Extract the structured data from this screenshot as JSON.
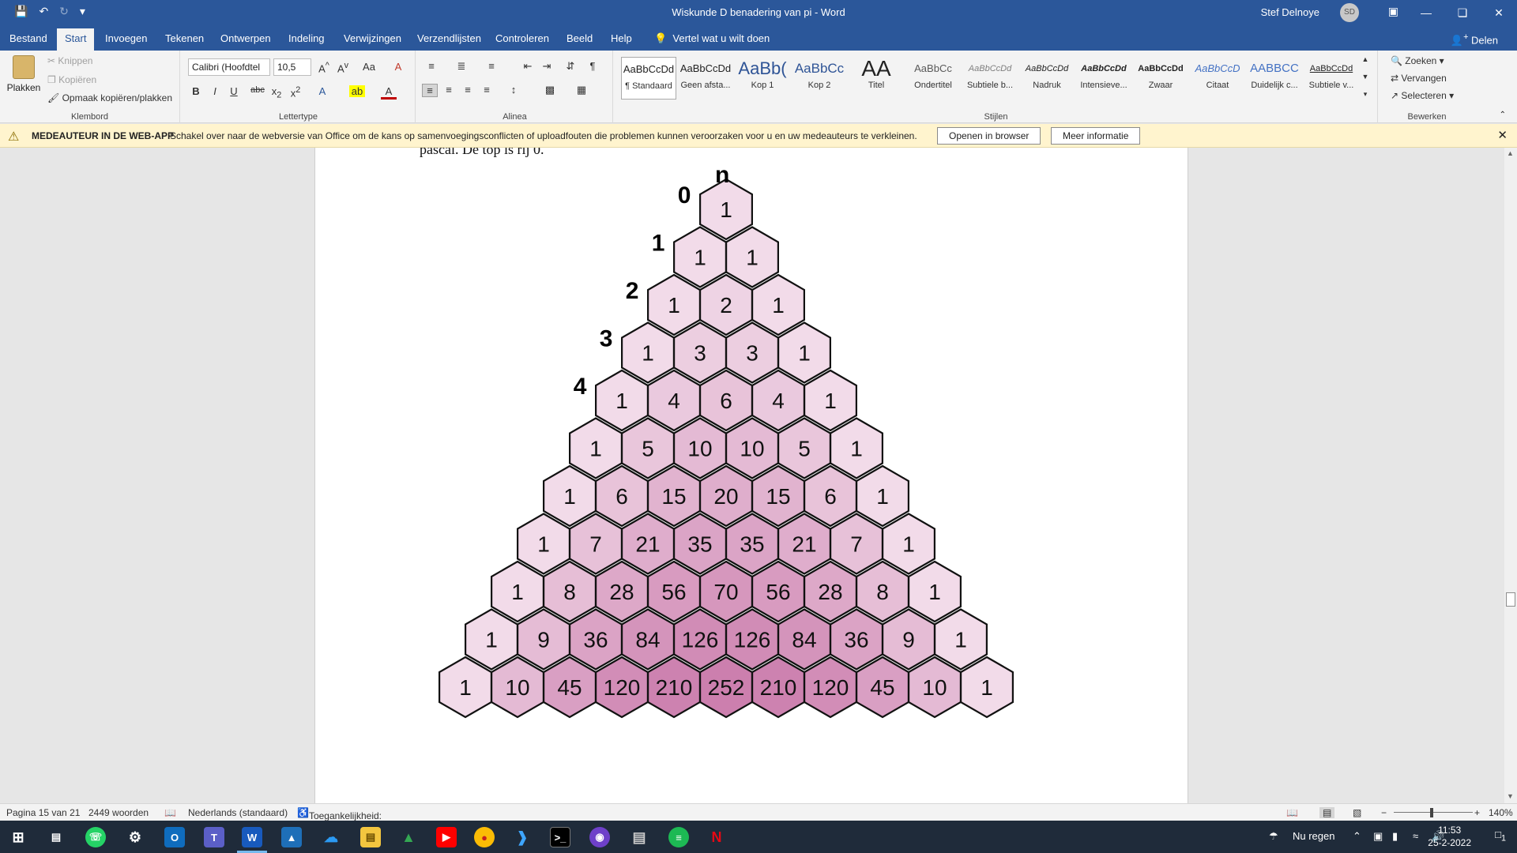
{
  "window": {
    "title": "Wiskunde D benadering van pi  -  Word",
    "user": "Stef Delnoye",
    "avatar_initials": "SD"
  },
  "tabs": [
    "Bestand",
    "Start",
    "Invoegen",
    "Tekenen",
    "Ontwerpen",
    "Indeling",
    "Verwijzingen",
    "Verzendlijsten",
    "Controleren",
    "Beeld",
    "Help"
  ],
  "tellme": "Vertel wat u wilt doen",
  "share": "Delen",
  "clipboard": {
    "paste": "Plakken",
    "cut": "Knippen",
    "copy": "Kopiëren",
    "format_painter": "Opmaak kopiëren/plakken",
    "label": "Klembord"
  },
  "font": {
    "name": "Calibri (Hoofdtel",
    "size": "10,5",
    "label": "Lettertype"
  },
  "paragraph_label": "Alinea",
  "styles": {
    "label": "Stijlen",
    "items": [
      {
        "sample": "AaBbCcDd",
        "name": "¶ Standaard"
      },
      {
        "sample": "AaBbCcDd",
        "name": "Geen afsta..."
      },
      {
        "sample": "AaBb(",
        "name": "Kop 1"
      },
      {
        "sample": "AaBbCc",
        "name": "Kop 2"
      },
      {
        "sample": "AA",
        "name": "Titel"
      },
      {
        "sample": "AaBbCc",
        "name": "Ondertitel"
      },
      {
        "sample": "AaBbCcDd",
        "name": "Subtiele b..."
      },
      {
        "sample": "AaBbCcDd",
        "name": "Nadruk"
      },
      {
        "sample": "AaBbCcDd",
        "name": "Intensieve..."
      },
      {
        "sample": "AaBbCcDd",
        "name": "Zwaar"
      },
      {
        "sample": "AaBbCcD",
        "name": "Citaat"
      },
      {
        "sample": "AABBCC",
        "name": "Duidelijk c..."
      },
      {
        "sample": "AaBbCcDd",
        "name": "Subtiele v..."
      }
    ]
  },
  "editing": {
    "find": "Zoeken",
    "replace": "Vervangen",
    "select": "Selecteren",
    "label": "Bewerken"
  },
  "message_bar": {
    "title": "MEDEAUTEUR IN DE WEB-APP",
    "text": "Schakel over naar de webversie van Office om de kans op samenvoegingsconflicten of uploadfouten die problemen kunnen veroorzaken voor u en uw medeauteurs te verkleinen.",
    "open_button": "Openen in browser",
    "info_button": "Meer informatie"
  },
  "document": {
    "partial_text": "pascal. De top is rij 0.",
    "n_label": "n",
    "row_labels": [
      "0",
      "1",
      "2",
      "3",
      "4"
    ]
  },
  "pascal_rows": [
    [
      1
    ],
    [
      1,
      1
    ],
    [
      1,
      2,
      1
    ],
    [
      1,
      3,
      3,
      1
    ],
    [
      1,
      4,
      6,
      4,
      1
    ],
    [
      1,
      5,
      10,
      10,
      5,
      1
    ],
    [
      1,
      6,
      15,
      20,
      15,
      6,
      1
    ],
    [
      1,
      7,
      21,
      35,
      35,
      21,
      7,
      1
    ],
    [
      1,
      8,
      28,
      56,
      70,
      56,
      28,
      8,
      1
    ],
    [
      1,
      9,
      36,
      84,
      126,
      126,
      84,
      36,
      9,
      1
    ],
    [
      1,
      10,
      45,
      120,
      210,
      252,
      210,
      120,
      45,
      10,
      1
    ]
  ],
  "statusbar": {
    "page": "Pagina 15 van 21",
    "words": "2449 woorden",
    "language": "Nederlands (standaard)",
    "accessibility": "Toegankelijkheid: onderzoeken",
    "zoom": "140%"
  },
  "taskbar": {
    "weather": "Nu regen",
    "time": "11:53",
    "date": "25-2-2022",
    "notifications": "1"
  },
  "colors": {
    "word_blue": "#2b579a",
    "hex_light": "#f7e8f1",
    "hex_dark": "#cc7fae"
  }
}
